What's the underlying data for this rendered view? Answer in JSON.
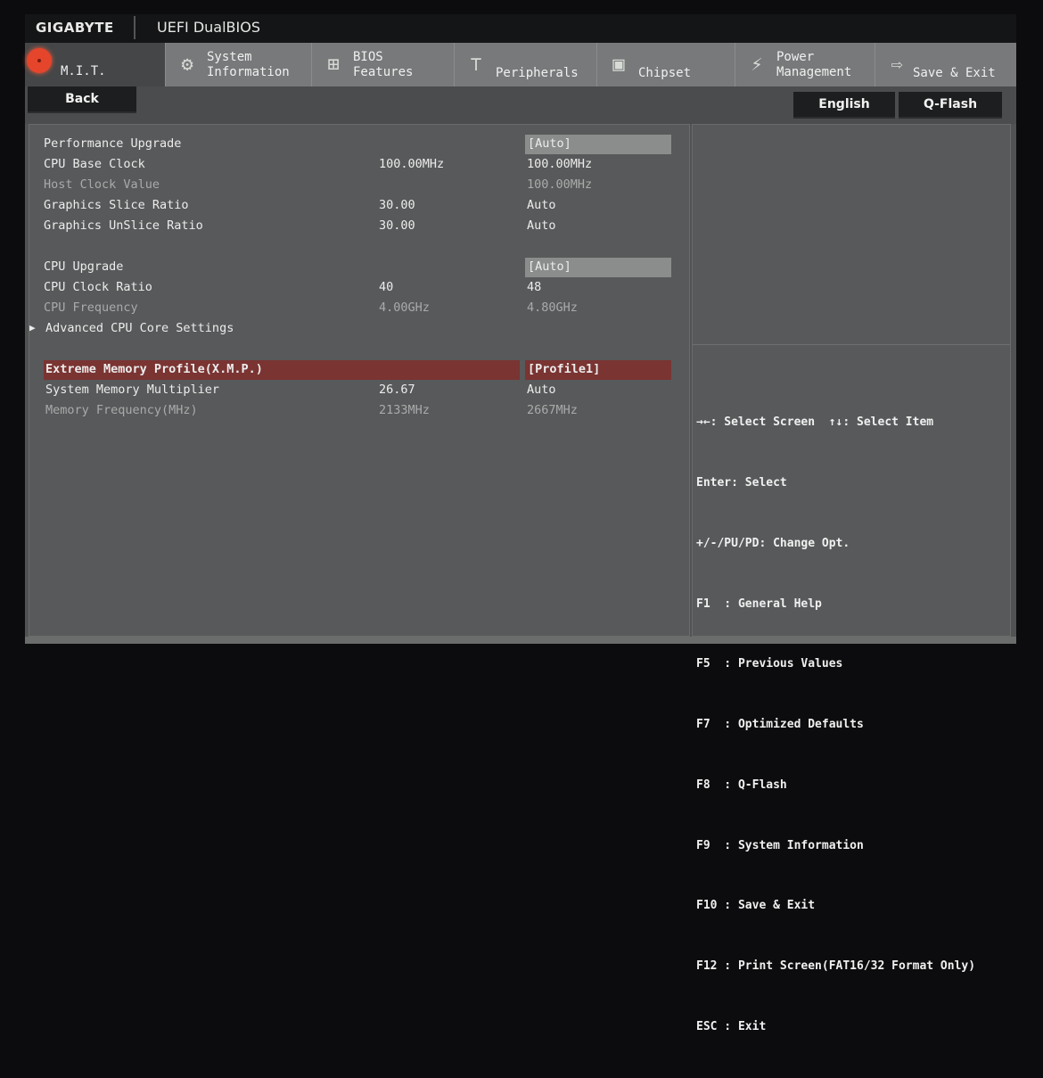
{
  "header": {
    "brand": "GIGABYTE",
    "title": "UEFI DualBIOS"
  },
  "tabs": [
    {
      "label": "M.I.T.",
      "icon": "mit-dial-icon",
      "active": true
    },
    {
      "label": "System\nInformation",
      "icon": "gear-icon"
    },
    {
      "label": "BIOS\nFeatures",
      "icon": "bios-features-icon"
    },
    {
      "label": "Peripherals",
      "icon": "peripherals-icon"
    },
    {
      "label": "Chipset",
      "icon": "chip-icon"
    },
    {
      "label": "Power\nManagement",
      "icon": "power-bolt-icon"
    },
    {
      "label": "Save & Exit",
      "icon": "exit-icon"
    }
  ],
  "buttons": {
    "back": "Back",
    "language": "English",
    "qflash": "Q-Flash"
  },
  "settings": [
    {
      "label": "Performance Upgrade",
      "current": "",
      "value": "[Auto]",
      "boxed": true
    },
    {
      "label": "CPU Base Clock",
      "current": "100.00MHz",
      "value": "100.00MHz"
    },
    {
      "label": "Host Clock Value",
      "current": "",
      "value": "100.00MHz",
      "dim": true
    },
    {
      "label": "Graphics Slice Ratio",
      "current": "30.00",
      "value": "Auto"
    },
    {
      "label": "Graphics UnSlice Ratio",
      "current": "30.00",
      "value": "Auto"
    },
    {
      "label": "CPU Upgrade",
      "current": "",
      "value": "[Auto]",
      "boxed": true
    },
    {
      "label": "CPU Clock Ratio",
      "current": "40",
      "value": "48"
    },
    {
      "label": "CPU Frequency",
      "current": "4.00GHz",
      "value": "4.80GHz",
      "dim": true
    },
    {
      "label": "Advanced CPU Core Settings",
      "submenu": true
    },
    {
      "label": "Extreme Memory Profile(X.M.P.)",
      "current": "",
      "value": "[Profile1]",
      "selected": true
    },
    {
      "label": "System Memory Multiplier",
      "current": "26.67",
      "value": "Auto"
    },
    {
      "label": "Memory Frequency(MHz)",
      "current": "2133MHz",
      "value": "2667MHz",
      "dim": true
    }
  ],
  "help": [
    "→←: Select Screen  ↑↓: Select Item",
    "Enter: Select",
    "+/-/PU/PD: Change Opt.",
    "F1  : General Help",
    "F5  : Previous Values",
    "F7  : Optimized Defaults",
    "F8  : Q-Flash",
    "F9  : System Information",
    "F10 : Save & Exit",
    "F12 : Print Screen(FAT16/32 Format Only)",
    "ESC : Exit"
  ],
  "colors": {
    "selected_row": "#7a3432",
    "active_tab": "#444647",
    "tab": "#77797a",
    "mit_icon": "#e5452b"
  }
}
